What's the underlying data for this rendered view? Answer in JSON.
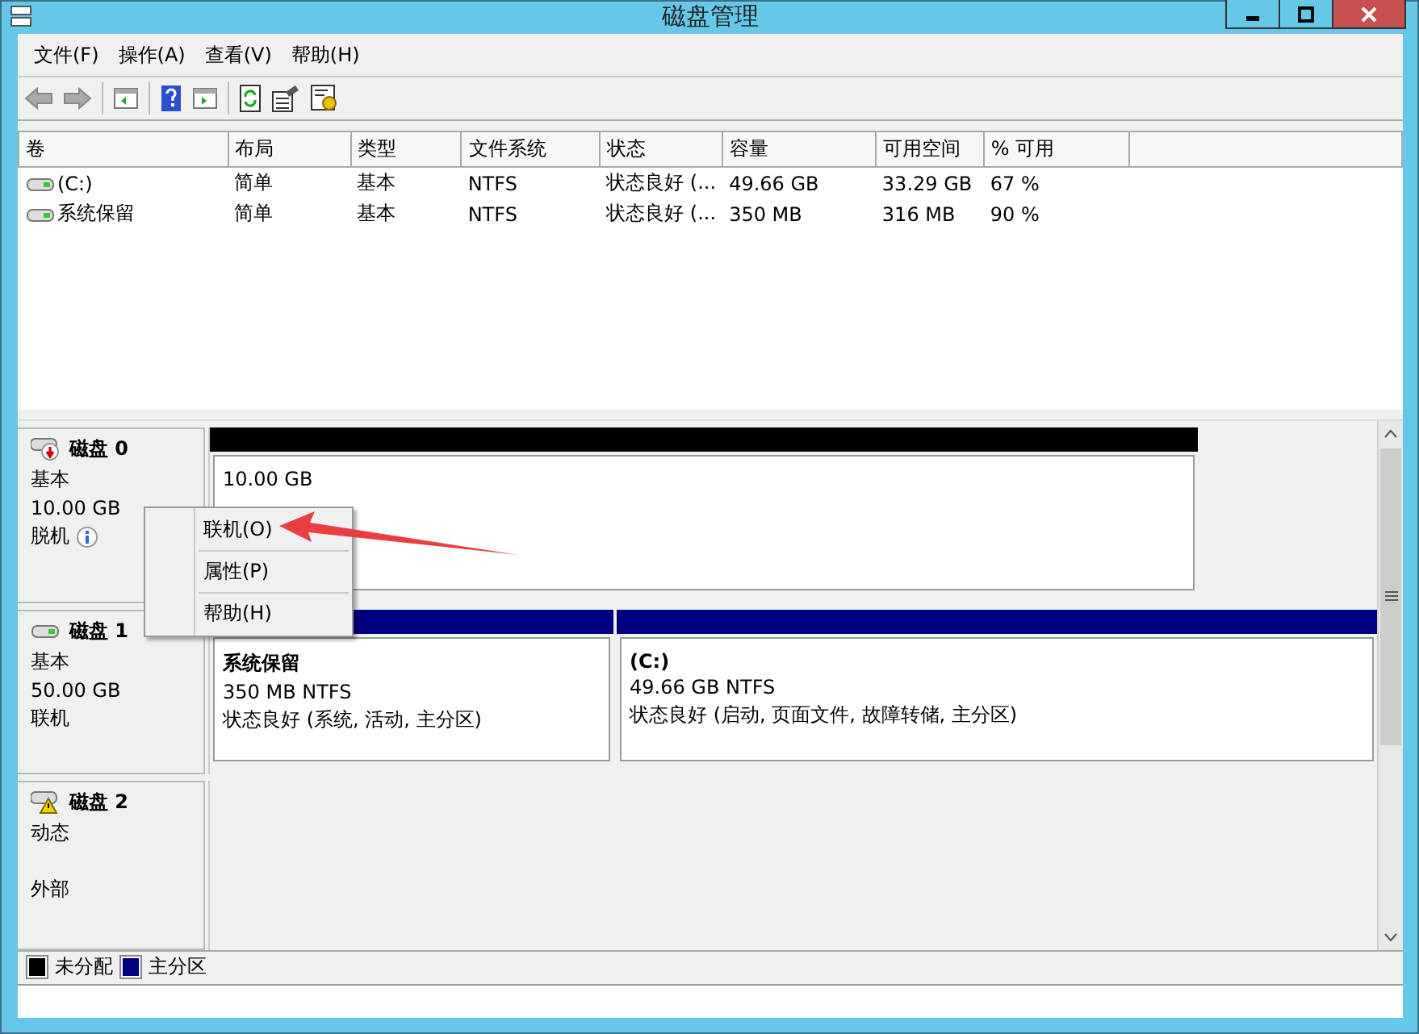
{
  "window": {
    "title": "磁盘管理"
  },
  "menu": [
    "文件(F)",
    "操作(A)",
    "查看(V)",
    "帮助(H)"
  ],
  "volumes": {
    "columns": [
      "卷",
      "布局",
      "类型",
      "文件系统",
      "状态",
      "容量",
      "可用空间",
      "% 可用"
    ],
    "rows": [
      {
        "cells": [
          "(C:)",
          "简单",
          "基本",
          "NTFS",
          "状态良好 (...",
          "49.66 GB",
          "33.29 GB",
          "67 %"
        ]
      },
      {
        "cells": [
          "系统保留",
          "简单",
          "基本",
          "NTFS",
          "状态良好 (...",
          "350 MB",
          "316 MB",
          "90 %"
        ]
      }
    ]
  },
  "disks": [
    {
      "name": "磁盘 0",
      "type": "基本",
      "size": "10.00 GB",
      "status": "脱机",
      "kind": "offline",
      "partitions": [
        {
          "kind": "unallocated",
          "lines": [
            "10.00 GB"
          ]
        }
      ]
    },
    {
      "name": "磁盘 1",
      "type": "基本",
      "size": "50.00 GB",
      "status": "联机",
      "kind": "online",
      "partitions": [
        {
          "kind": "primary",
          "title": "系统保留",
          "lines": [
            "350 MB NTFS",
            "状态良好 (系统, 活动, 主分区)"
          ]
        },
        {
          "kind": "primary",
          "title": "(C:)",
          "lines": [
            "49.66 GB NTFS",
            "状态良好 (启动, 页面文件, 故障转储, 主分区)"
          ]
        }
      ]
    },
    {
      "name": "磁盘 2",
      "type": "动态",
      "status": "外部",
      "kind": "foreign"
    }
  ],
  "context_menu": [
    "联机(O)",
    "属性(P)",
    "帮助(H)"
  ],
  "legend": [
    {
      "label": "未分配",
      "color": "#000000"
    },
    {
      "label": "主分区",
      "color": "#000080"
    }
  ]
}
